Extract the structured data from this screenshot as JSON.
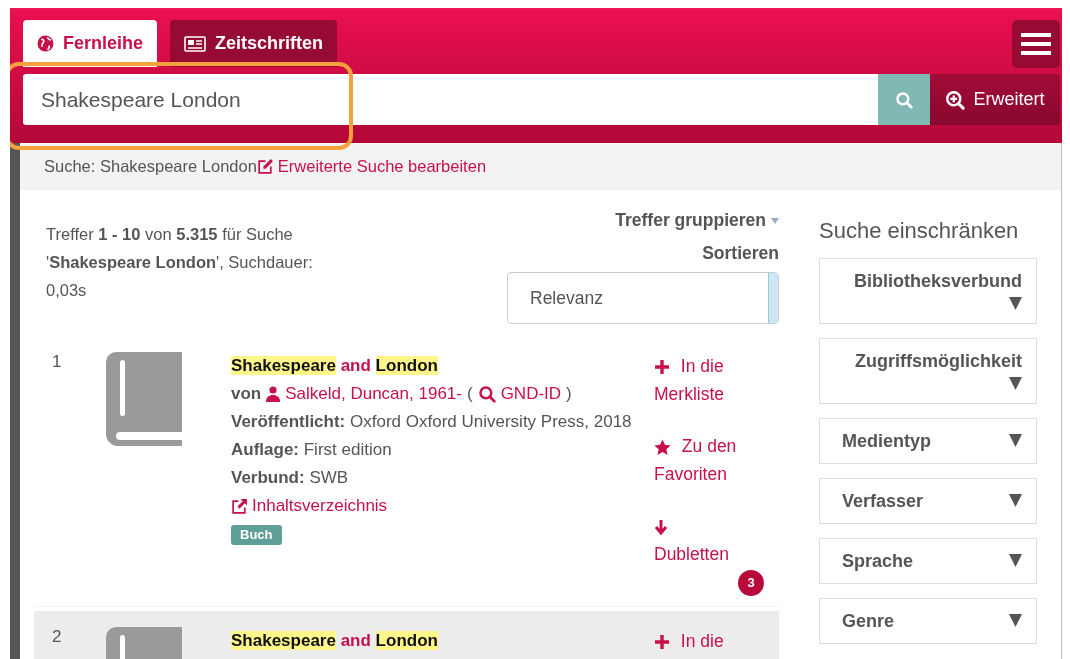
{
  "tabs": [
    {
      "label": "Fernleihe",
      "selected": true
    },
    {
      "label": "Zeitschriften",
      "selected": false
    }
  ],
  "search": {
    "value": "Shakespeare London",
    "advanced_label": "Erweitert"
  },
  "breadcrumb": {
    "text": "Suche: Shakespeare London",
    "edit_link": "Erweiterte Suche bearbeiten"
  },
  "summary": "Treffer **1 - 10** von **5.315** für Suche '**Shakespeare London**', Suchdauer: 0,03s",
  "group_label": "Treffer gruppieren",
  "sort_label": "Sortieren",
  "sort_value": "Relevanz",
  "results": [
    {
      "number": "1",
      "title": [
        {
          "text": "Shakespeare",
          "highlight": true
        },
        {
          "text": "and",
          "highlight": false
        },
        {
          "text": "London",
          "highlight": true
        }
      ],
      "by": "von",
      "author": "Salkeld, Duncan, 1961-",
      "paren_open": "(",
      "gnd": "GND-ID",
      "paren_close": ")",
      "fields": [
        "**Veröffentlicht:** Oxford Oxford University Press, 2018",
        "**Auflage:** First edition",
        "**Verbund:** SWB"
      ],
      "toc_link": "Inhaltsverzeichnis",
      "format": "Buch",
      "actions": [
        {
          "kind": "plus",
          "label": "In die Merkliste"
        },
        {
          "kind": "star",
          "label": "Zu den Favoriten"
        },
        {
          "kind": "down",
          "label": "Dubletten",
          "badge": "3"
        }
      ],
      "shaded": false
    },
    {
      "number": "2",
      "title": [
        {
          "text": "Shakespeare",
          "highlight": true
        },
        {
          "text": "and",
          "highlight": false
        },
        {
          "text": "London",
          "highlight": true
        }
      ],
      "actions": [
        {
          "kind": "plus",
          "label": "In die"
        }
      ],
      "shaded": true
    }
  ],
  "facets_title": "Suche einschränken",
  "facets": [
    {
      "label": "Bibliotheksverbund",
      "expanded": false
    },
    {
      "label": "Zugriffsmöglichkeit",
      "expanded": false
    },
    {
      "label": "Medientyp",
      "expanded": false
    },
    {
      "label": "Verfasser",
      "expanded": false
    },
    {
      "label": "Sprache",
      "expanded": false
    },
    {
      "label": "Genre",
      "expanded": false
    }
  ]
}
